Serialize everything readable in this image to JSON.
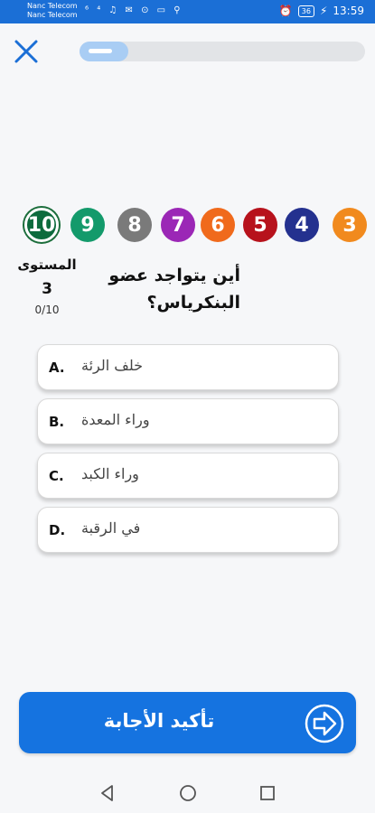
{
  "status_bar": {
    "carrier_1": "Nanc Telecom",
    "carrier_2": "Nanc Telecom",
    "icons": "⁶ ⁴ ♫ ✉ ⊙ ▭ ⚲",
    "battery": "36",
    "time": "13:59",
    "background": "#1b6fd6"
  },
  "header": {
    "progress": 0.17,
    "icons": {
      "close": "close-icon"
    }
  },
  "levels": [
    {
      "label": "10",
      "color": "#0d6b3d",
      "current": true
    },
    {
      "label": "9",
      "color": "#139a6b",
      "current": false
    },
    {
      "label": "8",
      "color": "#7a7a7a",
      "current": false
    },
    {
      "label": "7",
      "color": "#9b27b6",
      "current": false
    },
    {
      "label": "6",
      "color": "#f06a1c",
      "current": false
    },
    {
      "label": "5",
      "color": "#b7121c",
      "current": false
    },
    {
      "label": "4",
      "color": "#24318f",
      "current": false
    },
    {
      "label": "3",
      "color": "#f18a1e",
      "current": false
    }
  ],
  "level_info": {
    "title": "المستوى",
    "number": "3",
    "progress": "0/10"
  },
  "question": {
    "text": "أين يتواجد عضو البنكرياس؟"
  },
  "options": [
    {
      "letter": "A.",
      "text": "خلف الرئة"
    },
    {
      "letter": "B.",
      "text": "وراء المعدة"
    },
    {
      "letter": "C.",
      "text": "وراء الكبد"
    },
    {
      "letter": "D.",
      "text": "في الرقبة"
    }
  ],
  "confirm": {
    "label": "تأكيد الأجابة",
    "icon": "arrow-right-circle-icon",
    "color": "#1573e0"
  },
  "nav": {
    "icons": [
      "back-triangle-icon",
      "home-circle-icon",
      "recents-square-icon"
    ]
  }
}
